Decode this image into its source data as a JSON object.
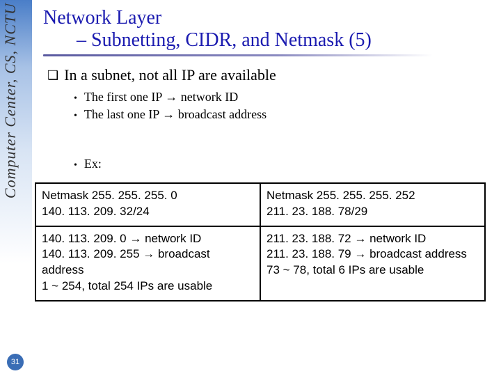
{
  "side": {
    "label": "Computer Center, CS, NCTU",
    "page_number": "31"
  },
  "title": {
    "line1": "Network Layer",
    "line2": "– Subnetting, CIDR, and Netmask (5)"
  },
  "main_bullet": "In a subnet, not all IP are available",
  "sub_bullets": [
    "The first one IP → network ID",
    "The last one IP → broadcast address"
  ],
  "example_label": "Ex:",
  "table": {
    "r1c1": "Netmask 255. 255. 255. 0\n140. 113. 209. 32/24",
    "r1c2": "Netmask 255. 255. 255. 252\n211. 23. 188. 78/29",
    "r2c1": "140. 113. 209. 0      → network ID\n140. 113. 209. 255  → broadcast address\n1 ~ 254, total 254 IPs are usable",
    "r2c2": "211. 23. 188. 72 → network ID\n211. 23. 188. 79 → broadcast address\n73 ~ 78, total 6 IPs are usable"
  }
}
